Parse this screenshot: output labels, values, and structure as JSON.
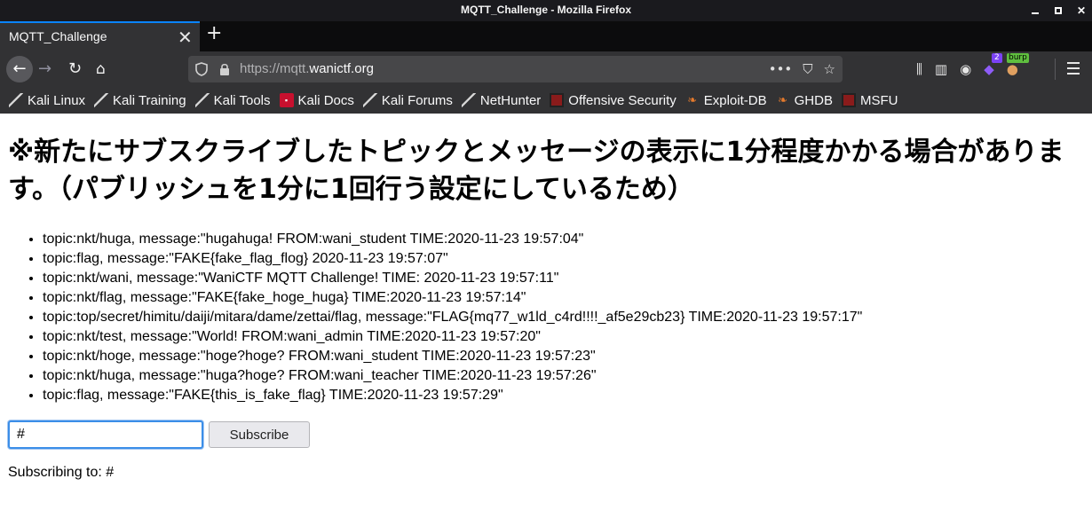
{
  "window": {
    "title": "MQTT_Challenge - Mozilla Firefox"
  },
  "tab": {
    "title": "MQTT_Challenge",
    "close": "✕",
    "new_tab": "+"
  },
  "urlbar": {
    "scheme_prefix": "https://mqtt.",
    "host": "wanictf.org",
    "more": "•••"
  },
  "toolbar": {
    "ext_count": "2",
    "burp_label": "burp"
  },
  "bookmarks": [
    {
      "label": "Kali Linux",
      "icon": "kali-dragon-icon"
    },
    {
      "label": "Kali Training",
      "icon": "kali-dragon-icon"
    },
    {
      "label": "Kali Tools",
      "icon": "kali-dragon-icon"
    },
    {
      "label": "Kali Docs",
      "icon": "pdf-icon"
    },
    {
      "label": "Kali Forums",
      "icon": "kali-dragon-icon"
    },
    {
      "label": "NetHunter",
      "icon": "kali-dragon-icon"
    },
    {
      "label": "Offensive Security",
      "icon": "offsec-icon"
    },
    {
      "label": "Exploit-DB",
      "icon": "exploit-db-icon"
    },
    {
      "label": "GHDB",
      "icon": "exploit-db-icon"
    },
    {
      "label": "MSFU",
      "icon": "offsec-icon"
    }
  ],
  "page": {
    "heading": "※新たにサブスクライブしたトピックとメッセージの表示に1分程度かかる場合があります。（パブリッシュを1分に1回行う設定にしているため）",
    "messages": [
      "topic:nkt/huga, message:\"hugahuga! FROM:wani_student TIME:2020-11-23 19:57:04\"",
      "topic:flag, message:\"FAKE{fake_flag_flog} 2020-11-23 19:57:07\"",
      "topic:nkt/wani, message:\"WaniCTF MQTT Challenge! TIME: 2020-11-23 19:57:11\"",
      "topic:nkt/flag, message:\"FAKE{fake_hoge_huga} TIME:2020-11-23 19:57:14\"",
      "topic:top/secret/himitu/daiji/mitara/dame/zettai/flag, message:\"FLAG{mq77_w1ld_c4rd!!!!_af5e29cb23} TIME:2020-11-23 19:57:17\"",
      "topic:nkt/test, message:\"World! FROM:wani_admin TIME:2020-11-23 19:57:20\"",
      "topic:nkt/hoge, message:\"hoge?hoge? FROM:wani_student TIME:2020-11-23 19:57:23\"",
      "topic:nkt/huga, message:\"huga?hoge? FROM:wani_teacher TIME:2020-11-23 19:57:26\"",
      "topic:flag, message:\"FAKE{this_is_fake_flag} TIME:2020-11-23 19:57:29\""
    ],
    "topic_input_value": "#",
    "subscribe_label": "Subscribe",
    "status": "Subscribing to: #"
  }
}
